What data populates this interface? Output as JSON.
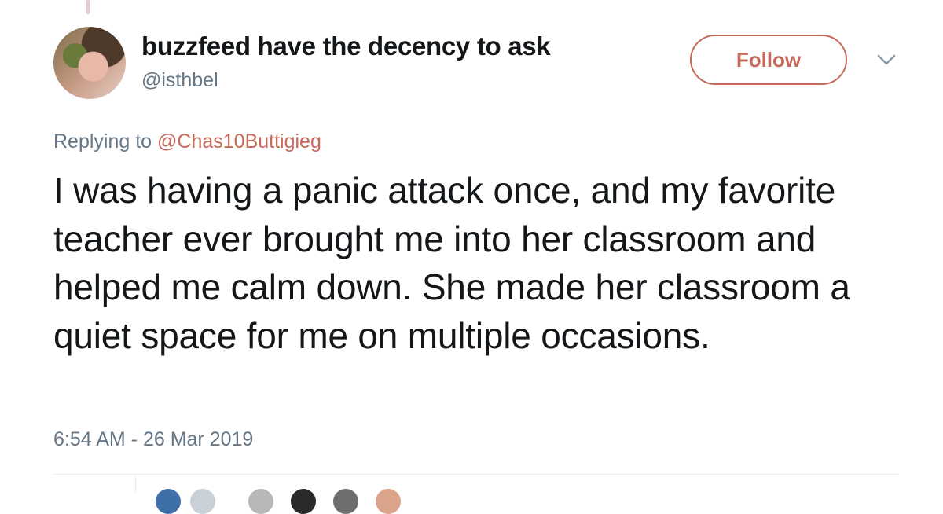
{
  "tweet": {
    "display_name": "buzzfeed have the decency to ask",
    "handle": "@isthbel",
    "follow_label": "Follow",
    "replying_prefix": "Replying to ",
    "replying_to": "@Chas10Buttigieg",
    "text": "I was having a panic attack once, and my favorite teacher ever brought me into her classroom and helped me calm down. She made her classroom a quiet space for me on multiple occasions.",
    "timestamp": "6:54 AM - 26 Mar 2019"
  },
  "colors": {
    "accent": "#c56a5b",
    "secondary_text": "#657786",
    "primary_text": "#14171a"
  },
  "icons": {
    "menu": "chevron-down-icon"
  }
}
